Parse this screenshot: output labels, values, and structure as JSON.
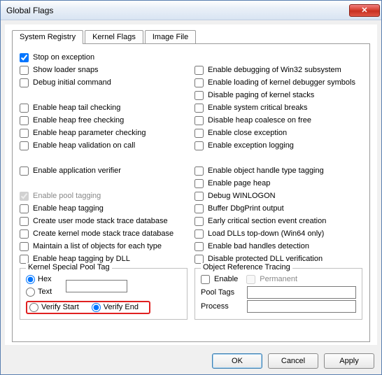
{
  "window": {
    "title": "Global Flags"
  },
  "tabs": [
    {
      "label": "System Registry"
    },
    {
      "label": "Kernel Flags"
    },
    {
      "label": "Image File"
    }
  ],
  "left": {
    "stop_exception": "Stop on exception",
    "show_loader": "Show loader snaps",
    "debug_init": "Debug initial command",
    "heap_tail": "Enable heap tail checking",
    "heap_free": "Enable heap free checking",
    "heap_param": "Enable heap parameter checking",
    "heap_valid": "Enable heap validation on call",
    "app_verifier": "Enable application verifier",
    "pool_tag": "Enable pool tagging",
    "heap_tagging": "Enable heap tagging",
    "user_stack": "Create user mode stack trace database",
    "kernel_stack": "Create kernel mode stack trace database",
    "maintain_list": "Maintain a list of objects for each type",
    "heap_tag_dll": "Enable heap tagging by DLL"
  },
  "right": {
    "win32_debug": "Enable debugging of Win32 subsystem",
    "kdbg_symbols": "Enable loading of kernel debugger symbols",
    "disable_paging": "Disable paging of kernel stacks",
    "sys_critical": "Enable system critical breaks",
    "disable_coalesce": "Disable heap coalesce on free",
    "close_exc": "Enable close exception",
    "exc_logging": "Enable exception logging",
    "obj_type_tag": "Enable object handle type tagging",
    "page_heap": "Enable page heap",
    "debug_winlogon": "Debug WINLOGON",
    "buffer_dbgprint": "Buffer DbgPrint output",
    "early_critical": "Early critical section event creation",
    "load_dlls_top": "Load DLLs top-down (Win64 only)",
    "bad_handles": "Enable bad handles detection",
    "disable_dll_ver": "Disable protected DLL verification"
  },
  "kspt": {
    "legend": "Kernel Special Pool Tag",
    "hex": "Hex",
    "text": "Text",
    "verify_start": "Verify Start",
    "verify_end": "Verify End",
    "value": ""
  },
  "ort": {
    "legend": "Object Reference Tracing",
    "enable": "Enable",
    "permanent": "Permanent",
    "pool_tags_label": "Pool Tags",
    "process_label": "Process",
    "pool_tags_value": "",
    "process_value": ""
  },
  "buttons": {
    "ok": "OK",
    "cancel": "Cancel",
    "apply": "Apply"
  }
}
